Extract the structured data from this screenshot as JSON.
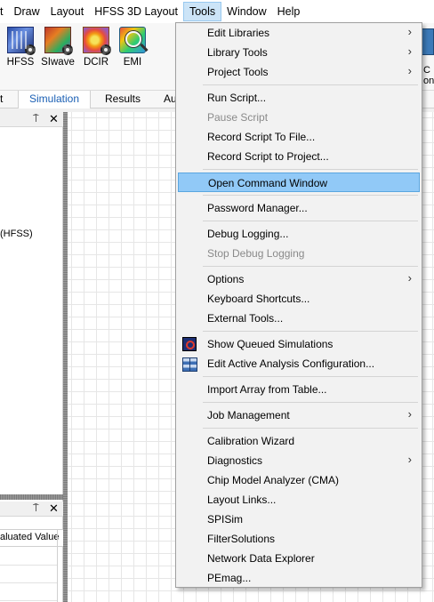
{
  "menubar": {
    "items": [
      "t",
      "Draw",
      "Layout",
      "HFSS 3D Layout",
      "Tools",
      "Window",
      "Help"
    ],
    "active": "Tools"
  },
  "ribbon": {
    "buttons": [
      {
        "label": "HFSS",
        "icon": "hfss-icon"
      },
      {
        "label": "SIwave",
        "icon": "siwave-icon"
      },
      {
        "label": "DCIR",
        "icon": "dcir-icon"
      },
      {
        "label": "EMI",
        "icon": "emi-icon"
      }
    ],
    "clipped_label": "C\non",
    "tabs": [
      "t",
      "Simulation",
      "Results",
      "Au"
    ],
    "selected_tab": "Simulation"
  },
  "left_panel": {
    "pin_glyph": "⍑",
    "close_glyph": "✕",
    "tree_text": "(HFSS)"
  },
  "bottom_panel": {
    "pin_glyph": "⍑",
    "close_glyph": "✕",
    "column_header": "aluated Value"
  },
  "tools_menu": {
    "items": [
      {
        "label": "Edit Libraries",
        "submenu": true
      },
      {
        "label": "Library Tools",
        "submenu": true
      },
      {
        "label": "Project Tools",
        "submenu": true
      },
      {
        "label": "Run Script..."
      },
      {
        "label": "Pause Script",
        "disabled": true
      },
      {
        "label": "Record Script To File..."
      },
      {
        "label": "Record Script to Project..."
      },
      {
        "label": "Open Command Window",
        "highlighted": true
      },
      {
        "label": "Password Manager..."
      },
      {
        "label": "Debug Logging..."
      },
      {
        "label": "Stop Debug Logging",
        "disabled": true
      },
      {
        "label": "Options",
        "submenu": true
      },
      {
        "label": "Keyboard Shortcuts..."
      },
      {
        "label": "External Tools..."
      },
      {
        "label": "Show Queued Simulations",
        "icon": "queued-simulations-icon"
      },
      {
        "label": "Edit Active Analysis Configuration...",
        "icon": "analysis-config-icon"
      },
      {
        "label": "Import Array from Table..."
      },
      {
        "label": "Job Management",
        "submenu": true
      },
      {
        "label": "Calibration Wizard"
      },
      {
        "label": "Diagnostics",
        "submenu": true
      },
      {
        "label": "Chip Model Analyzer (CMA)"
      },
      {
        "label": "Layout Links..."
      },
      {
        "label": "SPISim"
      },
      {
        "label": "FilterSolutions"
      },
      {
        "label": "Network Data Explorer"
      },
      {
        "label": "PEmag..."
      }
    ],
    "submenu_arrow": "›",
    "colors": {
      "highlight": "#91c9f7",
      "highlight_border": "#5aa6e0",
      "disabled_text": "#8a8a8a"
    }
  }
}
